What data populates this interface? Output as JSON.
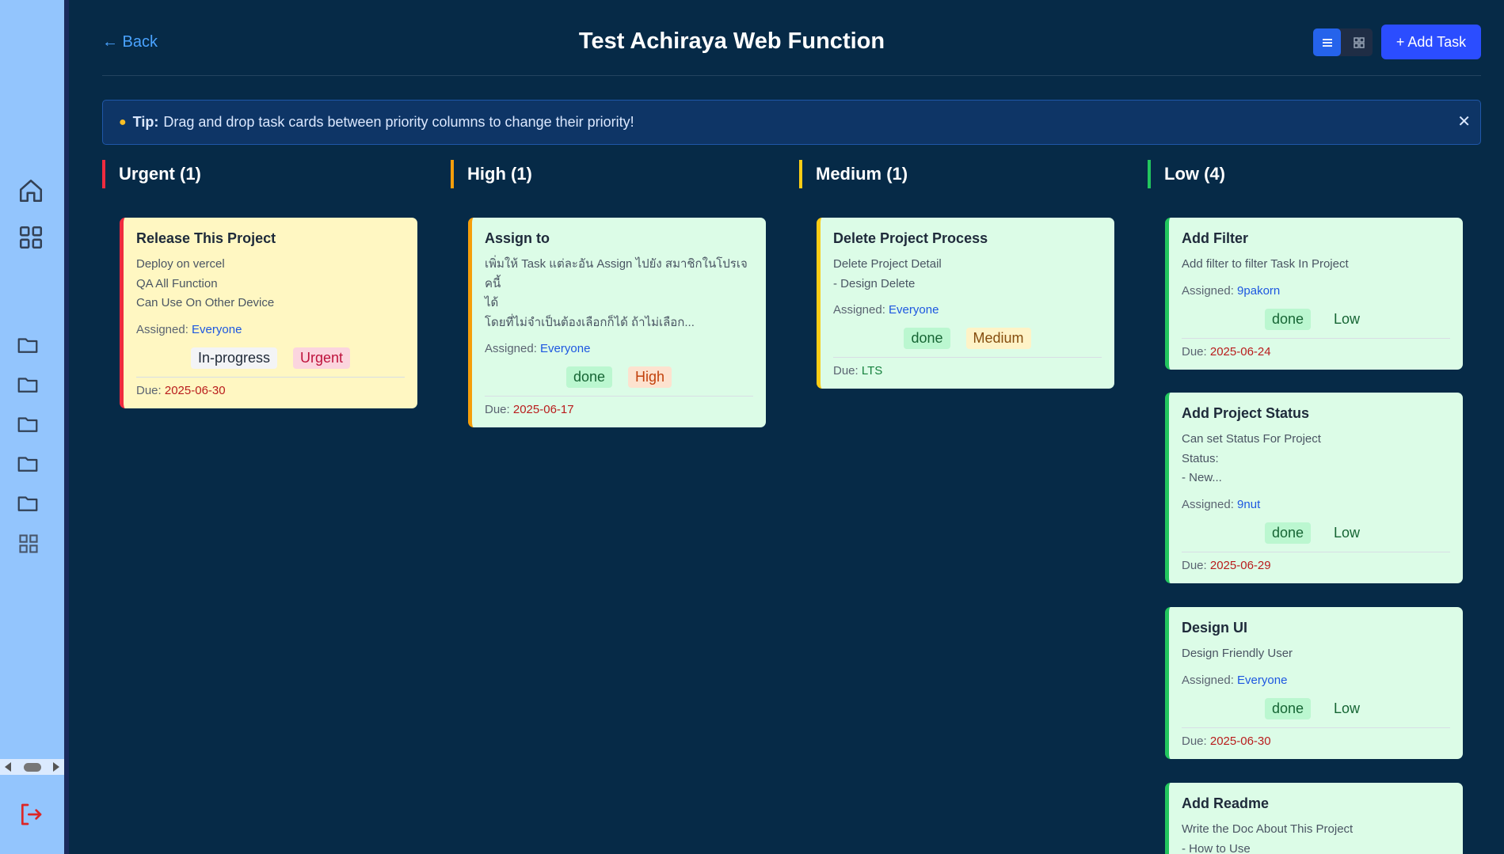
{
  "header": {
    "back_label": "← Back",
    "title": "Test Achiraya Web Function",
    "add_task_label": "+ Add Task"
  },
  "tip": {
    "bold": "Tip:",
    "text": "Drag and drop task cards between priority columns to change their priority!",
    "close": "✕"
  },
  "columns": [
    {
      "title": "Urgent (1)",
      "cards": [
        {
          "title": "Release This Project",
          "desc": [
            "Deploy on vercel",
            "QA All Function",
            "Can Use On Other Device"
          ],
          "assigned_label": "Assigned:",
          "assigned_to": "Everyone",
          "status": "In-progress",
          "priority": "Urgent",
          "due_label": "Due:",
          "due": "2025-06-30"
        }
      ]
    },
    {
      "title": "High (1)",
      "cards": [
        {
          "title": "Assign to",
          "desc": [
            "เพิ่มให้ Task แต่ละอัน Assign ไปยัง สมาชิกในโปรเจคนี้",
            "ได้",
            "โดยที่ไม่จำเป็นต้องเลือกก็ได้ ถ้าไม่เลือก..."
          ],
          "assigned_label": "Assigned:",
          "assigned_to": "Everyone",
          "status": "done",
          "priority": "High",
          "due_label": "Due:",
          "due": "2025-06-17"
        }
      ]
    },
    {
      "title": "Medium (1)",
      "cards": [
        {
          "title": "Delete Project Process",
          "desc": [
            "Delete Project Detail",
            "- Design Delete"
          ],
          "assigned_label": "Assigned:",
          "assigned_to": "Everyone",
          "status": "done",
          "priority": "Medium",
          "due_label": "Due:",
          "due": "LTS"
        }
      ]
    },
    {
      "title": "Low (4)",
      "cards": [
        {
          "title": "Add Filter",
          "desc": [
            "Add filter to filter Task In Project"
          ],
          "assigned_label": "Assigned:",
          "assigned_to": "9pakorn",
          "status": "done",
          "priority": "Low",
          "due_label": "Due:",
          "due": "2025-06-24"
        },
        {
          "title": "Add Project Status",
          "desc": [
            "Can set Status For Project",
            "Status:",
            "- New..."
          ],
          "assigned_label": "Assigned:",
          "assigned_to": "9nut",
          "status": "done",
          "priority": "Low",
          "due_label": "Due:",
          "due": "2025-06-29"
        },
        {
          "title": "Design UI",
          "desc": [
            "Design Friendly User"
          ],
          "assigned_label": "Assigned:",
          "assigned_to": "Everyone",
          "status": "done",
          "priority": "Low",
          "due_label": "Due:",
          "due": "2025-06-30"
        },
        {
          "title": "Add Readme",
          "desc": [
            "Write the Doc About This Project",
            "- How to Use"
          ]
        }
      ]
    }
  ],
  "colors": {
    "urgent": "#ef2b3f",
    "high": "#f59e0b",
    "medium": "#facc15",
    "low": "#22c55e",
    "card_urgent_bg": "#fff7c2",
    "card_bg": "#dcfce7",
    "sidebar_bg": "#93c5fd",
    "page_bg": "#062a47"
  },
  "icons": {
    "sidebar": [
      "home-icon",
      "grid-icon",
      "folder-icon",
      "folder-icon",
      "folder-icon",
      "folder-icon",
      "folder-icon",
      "grid-icon",
      "logout-icon"
    ],
    "view_toggle": [
      "list-icon",
      "grid-icon"
    ]
  }
}
